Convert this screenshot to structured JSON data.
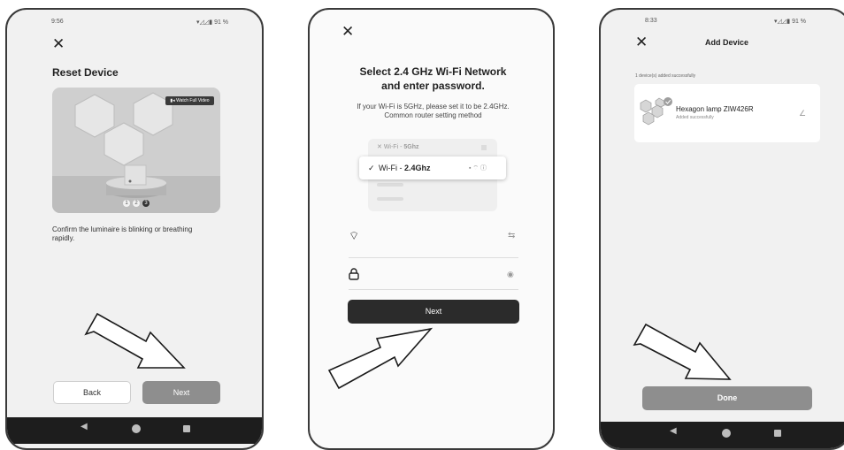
{
  "screen1": {
    "status_time": "9:56",
    "status_icons": "▾◿◿▮ 91 %",
    "close_glyph": "✕",
    "title": "Reset Device",
    "video_badge": "Watch Full Video",
    "steps": [
      "1",
      "2",
      "3"
    ],
    "instruction": "Confirm the luminaire is blinking or breathing rapidly.",
    "back_label": "Back",
    "next_label": "Next"
  },
  "screen2": {
    "close_glyph": "✕",
    "title_line1": "Select 2.4 GHz Wi-Fi Network",
    "title_line2": "and enter password.",
    "hint_line1": "If your Wi-Fi is 5GHz, please set it to be 2.4GHz.",
    "hint_line2": "Common router setting method",
    "network_5g_prefix": "Wi-Fi - ",
    "network_5g_name": "5Ghz",
    "network_24_prefix": "Wi-Fi - ",
    "network_24_name": "2.4Ghz",
    "next_label": "Next"
  },
  "screen3": {
    "status_time": "8:33",
    "status_icons": "▾◿◿▮ 91 %",
    "close_glyph": "✕",
    "title": "Add Device",
    "added_count": "1 device(s) added successfully",
    "device_name": "Hexagon lamp ZIW426R",
    "device_status": "Added successfully",
    "done_label": "Done"
  },
  "colors": {
    "dark_button": "#2b2b2b",
    "gray_button": "#8e8e8e",
    "nav_bar": "#1d1d1d",
    "frame": "#3a3a3a"
  }
}
